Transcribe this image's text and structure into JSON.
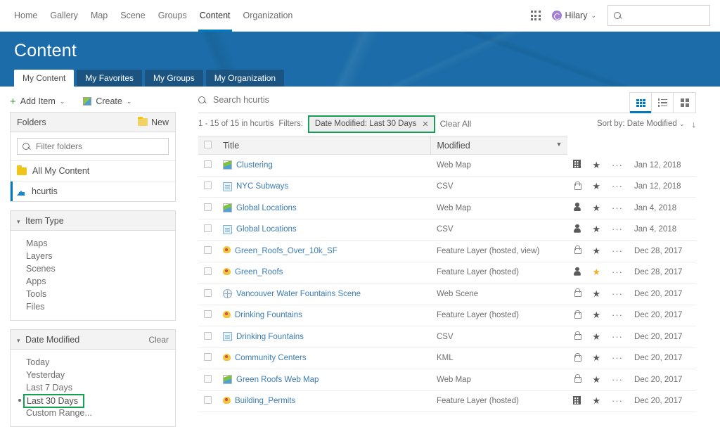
{
  "topnav": {
    "links": [
      "Home",
      "Gallery",
      "Map",
      "Scene",
      "Groups",
      "Content",
      "Organization"
    ],
    "active_link": "Content",
    "apps_icon": "app-grid-icon",
    "user": {
      "name": "Hilary",
      "avatar_icon": "user-avatar-icon",
      "chevron": "⌄"
    },
    "search": {
      "value": "",
      "placeholder": "",
      "icon": "search-icon"
    }
  },
  "banner": {
    "title": "Content",
    "tabs": [
      {
        "label": "My Content",
        "active": true
      },
      {
        "label": "My Favorites",
        "active": false
      },
      {
        "label": "My Groups",
        "active": false
      },
      {
        "label": "My Organization",
        "active": false
      }
    ]
  },
  "sidebar": {
    "actions": [
      {
        "label": "Add Item",
        "icon": "plus-icon",
        "chevron": "⌄"
      },
      {
        "label": "Create",
        "icon": "create-map-icon",
        "chevron": "⌄"
      }
    ],
    "folders_panel": {
      "title": "Folders",
      "new_label": "New",
      "new_icon": "new-folder-icon",
      "filter": {
        "value": "",
        "placeholder": "Filter folders",
        "icon": "search-icon"
      },
      "items": [
        {
          "label": "All My Content",
          "icon": "folder-icon",
          "active": false
        },
        {
          "label": "hcurtis",
          "icon": "home-folder-icon",
          "active": true
        }
      ]
    },
    "item_type_panel": {
      "title": "Item Type",
      "collapse_icon": "chevron-down-icon",
      "items": [
        "Maps",
        "Layers",
        "Scenes",
        "Apps",
        "Tools",
        "Files"
      ]
    },
    "date_modified_panel": {
      "title": "Date Modified",
      "collapse_icon": "chevron-down-icon",
      "clear_label": "Clear",
      "items": [
        {
          "label": "Today",
          "selected": false
        },
        {
          "label": "Yesterday",
          "selected": false
        },
        {
          "label": "Last 7 Days",
          "selected": false
        },
        {
          "label": "Last 30 Days",
          "selected": true,
          "highlight": true
        },
        {
          "label": "Custom Range...",
          "selected": false
        }
      ]
    }
  },
  "content": {
    "search": {
      "value": "",
      "placeholder": "Search hcurtis",
      "icon": "search-icon"
    },
    "view_toggles": [
      {
        "name": "table-view",
        "icon": "table-view-icon",
        "active": true
      },
      {
        "name": "list-view",
        "icon": "list-view-icon",
        "active": false
      },
      {
        "name": "grid-view",
        "icon": "grid-view-icon",
        "active": false
      }
    ],
    "result_count": "1 - 15 of 15 in hcurtis",
    "filters_label": "Filters:",
    "filter_chips": [
      {
        "label": "Date Modified: Last 30 Days",
        "remove_icon": "✕",
        "highlight": true
      }
    ],
    "clear_all_label": "Clear All",
    "sort_label": "Sort by: Date Modified",
    "sort_chevron": "⌄",
    "sort_direction_icon": "↓",
    "columns": {
      "select_all": "select-all-checkbox",
      "title": "Title",
      "modified": "Modified",
      "modified_caret": "▼"
    },
    "rows": [
      {
        "title": "Clustering",
        "icon": "web-map-icon",
        "type": "Web Map",
        "sharing": "org",
        "favorite": false,
        "date": "Jan 12, 2018"
      },
      {
        "title": "NYC Subways",
        "icon": "csv-icon",
        "type": "CSV",
        "sharing": "private",
        "favorite": false,
        "date": "Jan 12, 2018"
      },
      {
        "title": "Global Locations",
        "icon": "web-map-icon",
        "type": "Web Map",
        "sharing": "public",
        "favorite": false,
        "date": "Jan 4, 2018"
      },
      {
        "title": "Global Locations",
        "icon": "csv-icon",
        "type": "CSV",
        "sharing": "public",
        "favorite": false,
        "date": "Jan 4, 2018"
      },
      {
        "title": "Green_Roofs_Over_10k_SF",
        "icon": "feature-layer-icon",
        "type": "Feature Layer (hosted, view)",
        "sharing": "private",
        "favorite": false,
        "date": "Dec 28, 2017"
      },
      {
        "title": "Green_Roofs",
        "icon": "feature-layer-icon",
        "type": "Feature Layer (hosted)",
        "sharing": "public",
        "favorite": true,
        "date": "Dec 28, 2017"
      },
      {
        "title": "Vancouver Water Fountains Scene",
        "icon": "web-scene-icon",
        "type": "Web Scene",
        "sharing": "private",
        "favorite": false,
        "date": "Dec 20, 2017"
      },
      {
        "title": "Drinking Fountains",
        "icon": "feature-layer-icon",
        "type": "Feature Layer (hosted)",
        "sharing": "private",
        "favorite": false,
        "date": "Dec 20, 2017"
      },
      {
        "title": "Drinking Fountains",
        "icon": "csv-icon",
        "type": "CSV",
        "sharing": "private",
        "favorite": false,
        "date": "Dec 20, 2017"
      },
      {
        "title": "Community Centers",
        "icon": "feature-layer-icon",
        "type": "KML",
        "sharing": "private",
        "favorite": false,
        "date": "Dec 20, 2017"
      },
      {
        "title": "Green Roofs Web Map",
        "icon": "web-map-icon",
        "type": "Web Map",
        "sharing": "private",
        "favorite": false,
        "date": "Dec 20, 2017"
      },
      {
        "title": "Building_Permits",
        "icon": "feature-layer-icon",
        "type": "Feature Layer (hosted)",
        "sharing": "org",
        "favorite": false,
        "date": "Dec 20, 2017"
      }
    ]
  },
  "colors": {
    "brand_blue": "#0079c1",
    "banner_blue": "#1b6ca8",
    "tab_inactive": "#1b5480",
    "link_blue": "#3c7cb2",
    "highlight_green": "#12a150",
    "favorite_gold": "#f0b323",
    "folder_yellow": "#f0c419",
    "add_green": "#3a9b35"
  }
}
